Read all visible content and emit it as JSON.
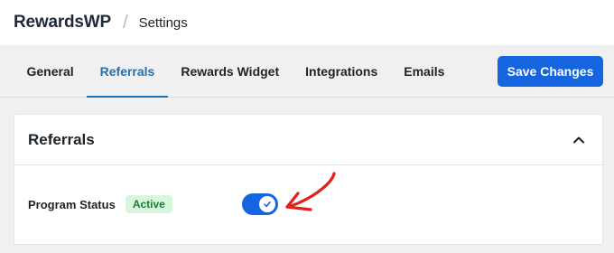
{
  "header": {
    "brand": "RewardsWP",
    "separator": "/",
    "page": "Settings"
  },
  "tabs": [
    {
      "label": "General",
      "active": false
    },
    {
      "label": "Referrals",
      "active": true
    },
    {
      "label": "Rewards Widget",
      "active": false
    },
    {
      "label": "Integrations",
      "active": false
    },
    {
      "label": "Emails",
      "active": false
    }
  ],
  "toolbar": {
    "save_label": "Save Changes"
  },
  "card": {
    "title": "Referrals",
    "collapse_icon": "chevron-up-icon"
  },
  "program_status": {
    "label": "Program Status",
    "badge": "Active",
    "enabled": true
  },
  "colors": {
    "accent": "#1565e0",
    "tab_active": "#2271b1",
    "badge_bg": "#d7f7dd",
    "badge_text": "#1a7f37",
    "annotation": "#e0201b"
  }
}
